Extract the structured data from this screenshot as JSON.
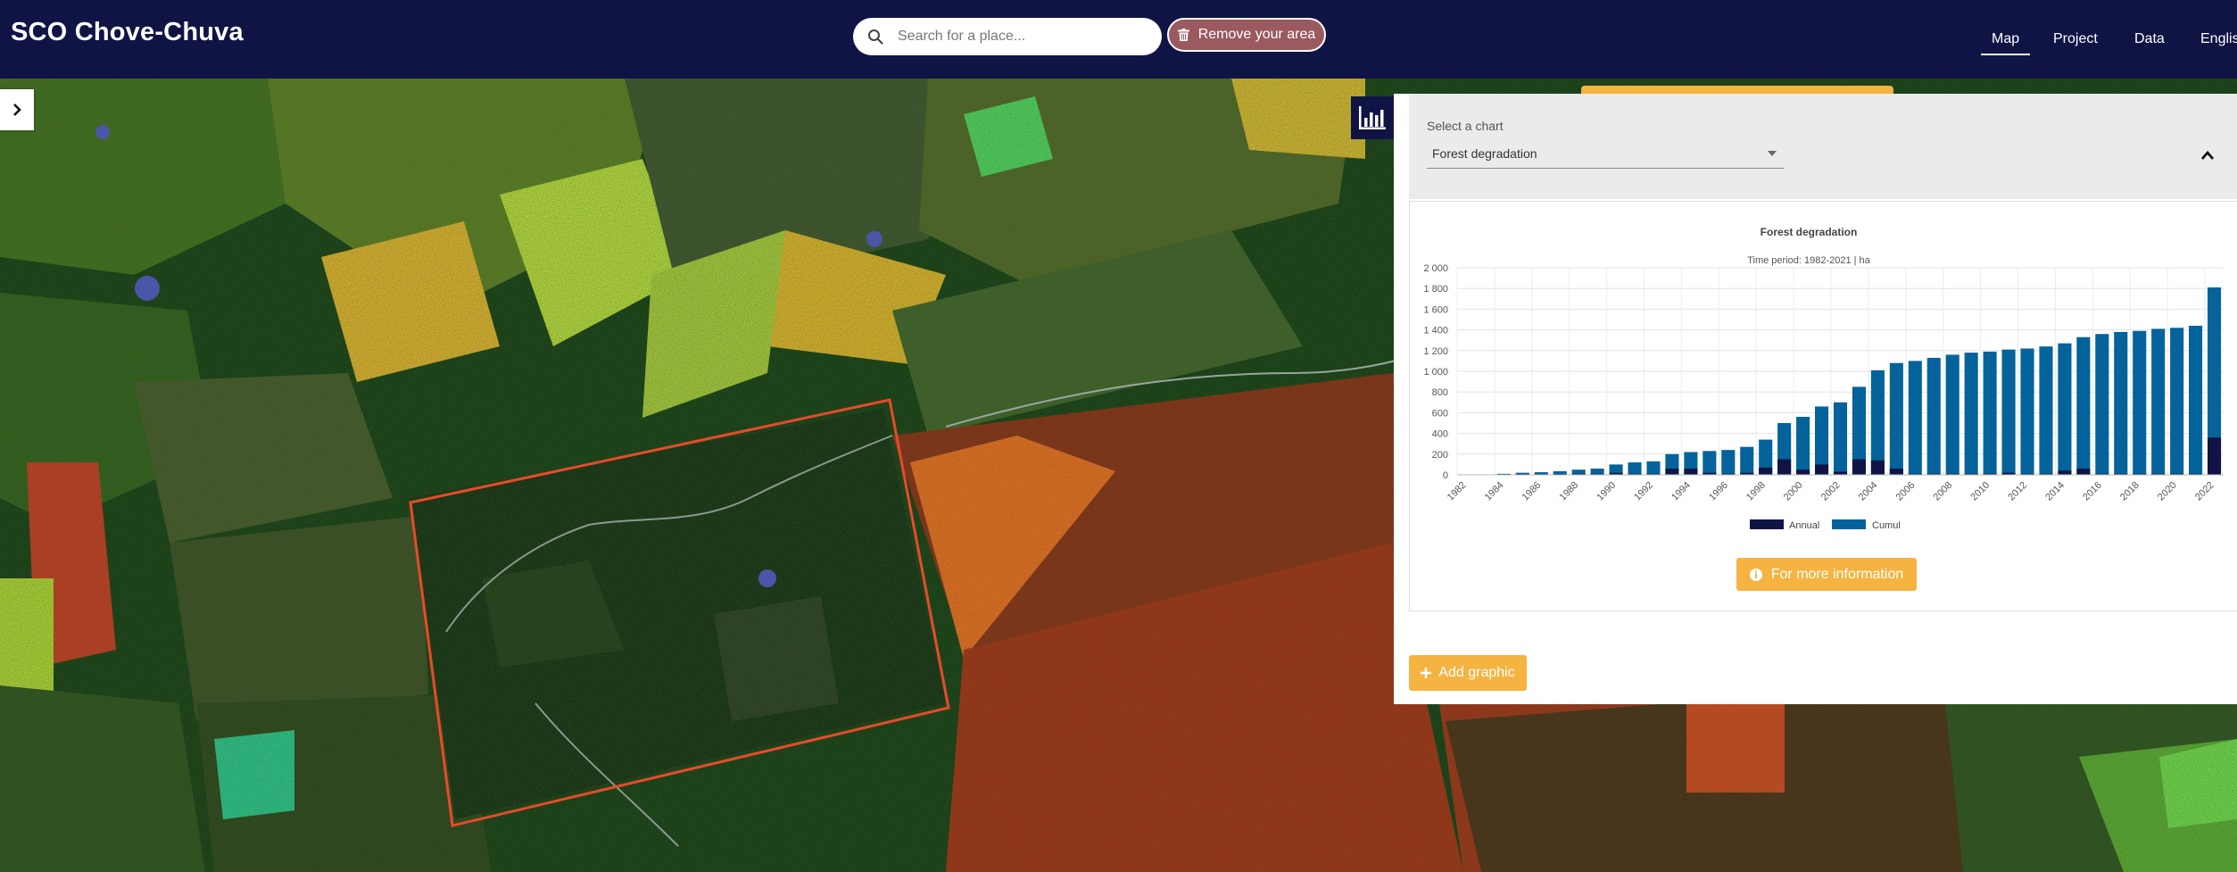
{
  "header": {
    "title": "SCO Chove-Chuva",
    "search_placeholder": "Search for a place...",
    "remove_area_label": "Remove your area",
    "nav": {
      "map": "Map",
      "project": "Project",
      "data": "Data",
      "language": "English"
    }
  },
  "panel": {
    "select_label": "Select a chart",
    "selected_chart": "Forest degradation",
    "more_info_label": "For more information",
    "add_graphic_label": "Add graphic"
  },
  "colors": {
    "header_bg": "#101445",
    "accent": "#f5b342",
    "annual": "#101445",
    "cumul": "#03639a"
  },
  "chart_data": {
    "type": "bar",
    "title": "Forest degradation",
    "subtitle": "Time period: 1982-2021 | ha",
    "xlabel": "",
    "ylabel": "",
    "ylim": [
      0,
      2000
    ],
    "yticks": [
      "0",
      "200",
      "400",
      "600",
      "800",
      "1 000",
      "1 200",
      "1 400",
      "1 600",
      "1 800",
      "2 000"
    ],
    "categories": [
      "1982",
      "1983",
      "1984",
      "1985",
      "1986",
      "1987",
      "1988",
      "1989",
      "1990",
      "1991",
      "1992",
      "1993",
      "1994",
      "1995",
      "1996",
      "1997",
      "1998",
      "1999",
      "2000",
      "2001",
      "2002",
      "2003",
      "2004",
      "2005",
      "2006",
      "2007",
      "2008",
      "2009",
      "2010",
      "2011",
      "2012",
      "2013",
      "2014",
      "2015",
      "2016",
      "2017",
      "2018",
      "2019",
      "2020",
      "2021",
      "2022"
    ],
    "xtick_labels": [
      "1982",
      "1984",
      "1986",
      "1988",
      "1990",
      "1992",
      "1994",
      "1996",
      "1998",
      "2000",
      "2002",
      "2004",
      "2006",
      "2008",
      "2010",
      "2012",
      "2014",
      "2016",
      "2018",
      "2020",
      "2022"
    ],
    "series": [
      {
        "name": "Annual",
        "color": "#101445",
        "values": [
          0,
          0,
          5,
          8,
          6,
          8,
          10,
          10,
          20,
          10,
          10,
          60,
          60,
          20,
          10,
          20,
          70,
          150,
          50,
          100,
          30,
          150,
          140,
          60,
          10,
          10,
          10,
          10,
          10,
          20,
          10,
          10,
          40,
          60,
          10,
          10,
          10,
          10,
          10,
          10,
          360
        ]
      },
      {
        "name": "Cumul",
        "color": "#03639a",
        "values": [
          0,
          0,
          10,
          20,
          25,
          35,
          50,
          60,
          100,
          120,
          130,
          200,
          220,
          230,
          240,
          270,
          340,
          500,
          560,
          660,
          700,
          850,
          1010,
          1080,
          1100,
          1130,
          1160,
          1180,
          1190,
          1210,
          1220,
          1240,
          1270,
          1330,
          1360,
          1380,
          1390,
          1410,
          1420,
          1440,
          1810
        ]
      }
    ],
    "legend": {
      "position": "bottom",
      "entries": [
        "Annual",
        "Cumul"
      ]
    },
    "grid": true
  }
}
